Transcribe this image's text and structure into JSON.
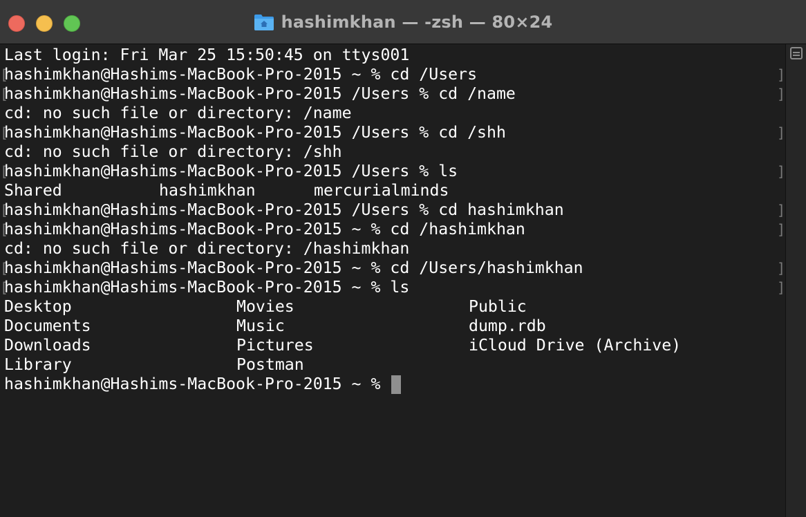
{
  "window": {
    "title": "hashimkhan — -zsh — 80×24",
    "title_icon": "home-folder-icon"
  },
  "terminal": {
    "lines": [
      {
        "text": "Last login: Fri Mar 25 15:50:45 on ttys001",
        "marked": false
      },
      {
        "text": "hashimkhan@Hashims-MacBook-Pro-2015 ~ % cd /Users",
        "marked": true
      },
      {
        "text": "hashimkhan@Hashims-MacBook-Pro-2015 /Users % cd /name",
        "marked": true
      },
      {
        "text": "cd: no such file or directory: /name",
        "marked": false
      },
      {
        "text": "hashimkhan@Hashims-MacBook-Pro-2015 /Users % cd /shh",
        "marked": true
      },
      {
        "text": "cd: no such file or directory: /shh",
        "marked": false
      },
      {
        "text": "hashimkhan@Hashims-MacBook-Pro-2015 /Users % ls",
        "marked": true
      },
      {
        "text": "",
        "marked": false
      },
      {
        "text": "hashimkhan@Hashims-MacBook-Pro-2015 /Users % cd hashimkhan",
        "marked": true
      },
      {
        "text": "hashimkhan@Hashims-MacBook-Pro-2015 ~ % cd /hashimkhan",
        "marked": true
      },
      {
        "text": "cd: no such file or directory: /hashimkhan",
        "marked": false
      },
      {
        "text": "hashimkhan@Hashims-MacBook-Pro-2015 ~ % cd /Users/hashimkhan",
        "marked": true
      },
      {
        "text": "hashimkhan@Hashims-MacBook-Pro-2015 ~ % ls",
        "marked": true
      }
    ],
    "users_listing": [
      "Shared",
      "hashimkhan",
      "mercurialminds"
    ],
    "home_listing": {
      "col1": [
        "Desktop",
        "Documents",
        "Downloads",
        "Library"
      ],
      "col2": [
        "Movies",
        "Music",
        "Pictures",
        "Postman"
      ],
      "col3": [
        "Public",
        "dump.rdb",
        "iCloud Drive (Archive)"
      ]
    },
    "prompt": "hashimkhan@Hashims-MacBook-Pro-2015 ~ %",
    "colors": {
      "background": "#1e1e1e",
      "text": "#ffffff",
      "cursor": "#8f8f8f",
      "titlebar": "#383838"
    }
  }
}
